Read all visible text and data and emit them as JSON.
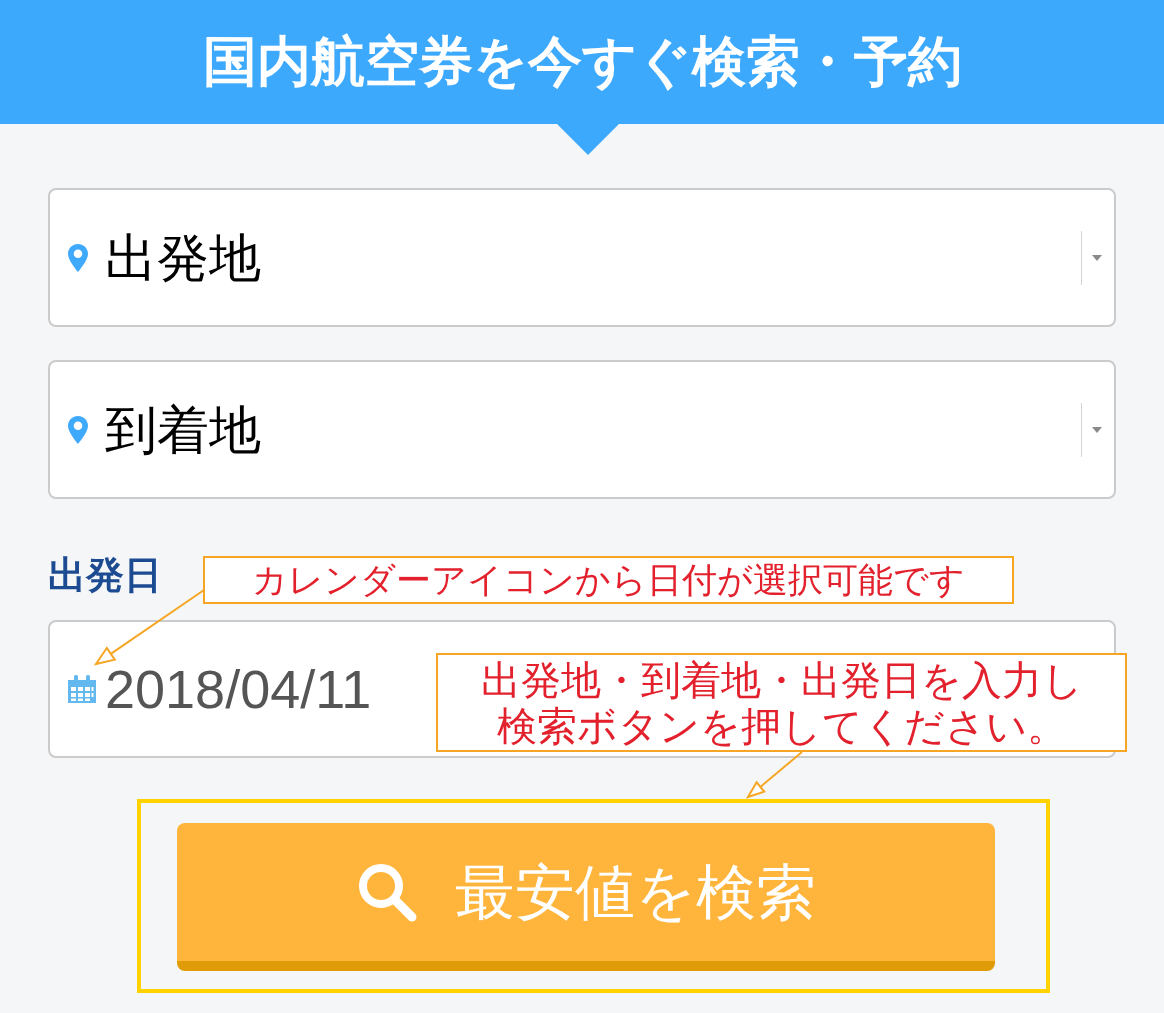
{
  "header": {
    "title": "国内航空券を今すぐ検索・予約"
  },
  "fields": [
    {
      "kind": "select",
      "placeholder": "出発地"
    },
    {
      "kind": "select",
      "placeholder": "到着地"
    }
  ],
  "date": {
    "label": "出発日",
    "value": "2018/04/11"
  },
  "search_button": {
    "label": "最安値を検索"
  },
  "annotations": [
    {
      "lines": [
        "カレンダーアイコンから日付が選択可能です"
      ]
    },
    {
      "lines": [
        "出発地・到着地・出発日を入力し",
        "検索ボタンを押してください。"
      ]
    }
  ]
}
